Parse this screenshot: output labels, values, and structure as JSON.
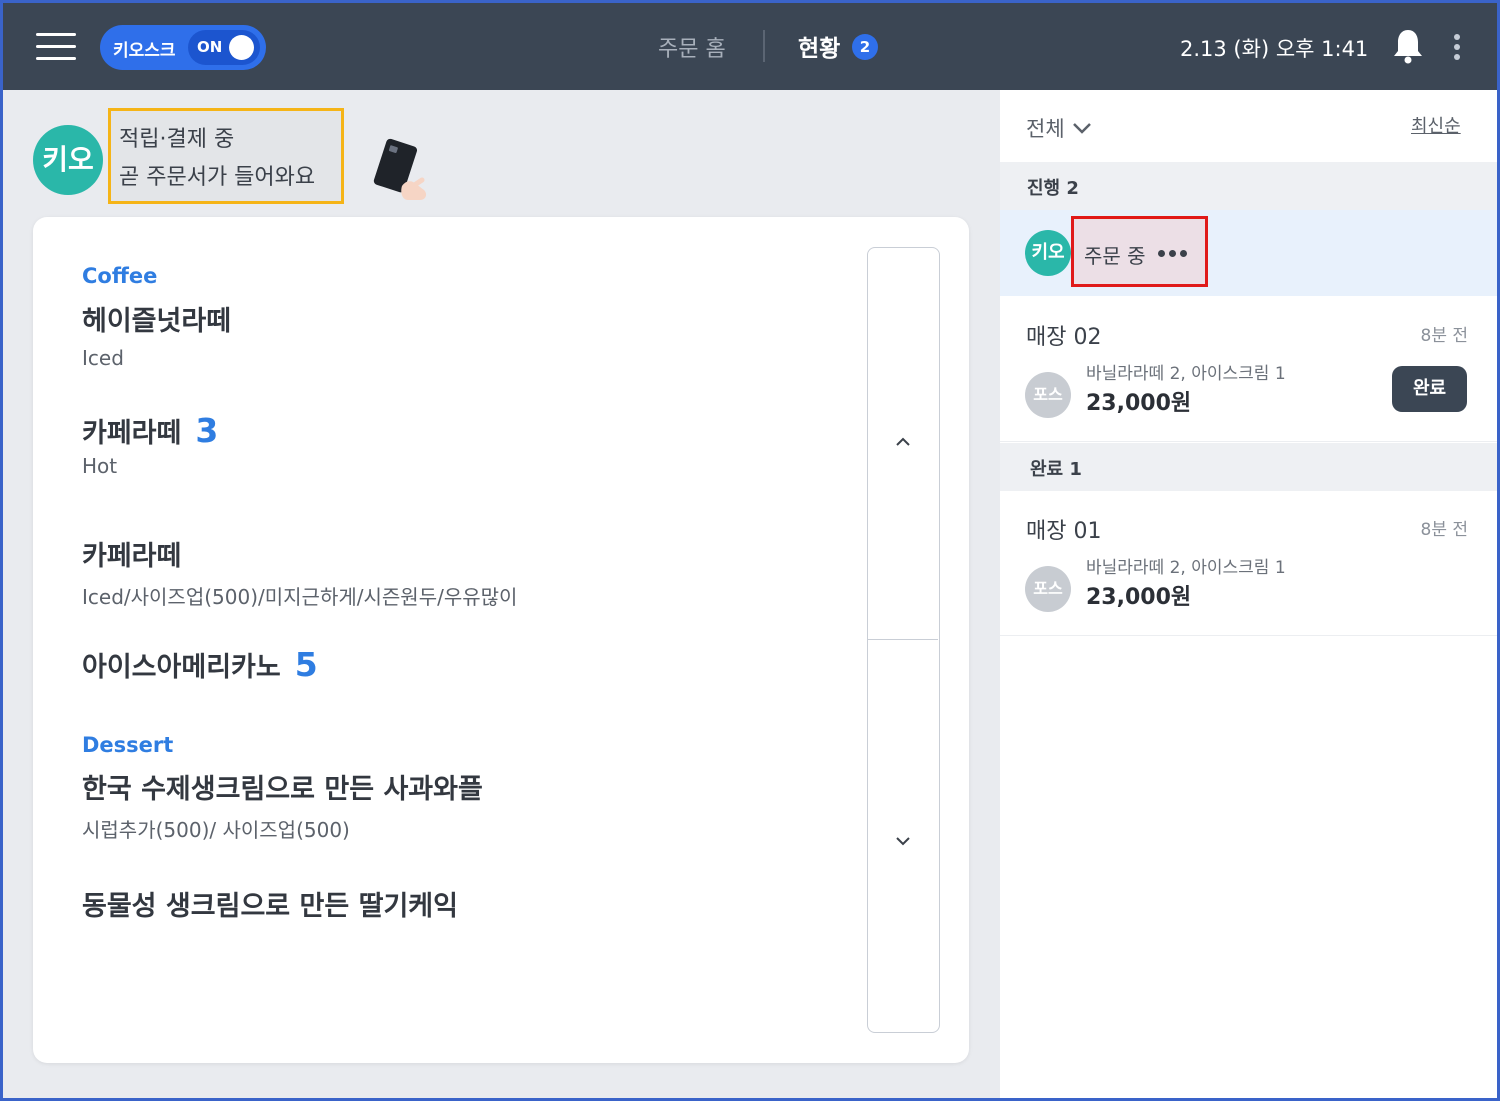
{
  "topbar": {
    "kiosk_label": "키오스크",
    "kiosk_toggle_state": "ON",
    "nav_home": "주문 홈",
    "nav_status": "현황",
    "status_badge": "2",
    "datetime": "2.13 (화) 오후 1:41",
    "icons": [
      "menu-icon",
      "bell-icon",
      "more-vertical-icon"
    ]
  },
  "notice": {
    "avatar": "키오",
    "line1": "적립·결제 중",
    "line2": "곧 주문서가 들어와요",
    "icon": "card-tap-icon"
  },
  "order_card": {
    "categories": [
      {
        "label": "Coffee",
        "items": [
          {
            "name": "헤이즐넛라떼",
            "qty": "",
            "options": "Iced"
          },
          {
            "name": "카페라떼",
            "qty": "3",
            "options": "Hot"
          },
          {
            "name": "카페라떼",
            "qty": "",
            "options": "Iced/사이즈업(500)/미지근하게/시즌원두/우유많이"
          },
          {
            "name": "아이스아메리카노",
            "qty": "5",
            "options": ""
          }
        ]
      },
      {
        "label": "Dessert",
        "items": [
          {
            "name": "한국 수제생크림으로 만든 사과와플",
            "qty": "",
            "options": "시럽추가(500)/ 사이즈업(500)"
          },
          {
            "name": "동물성 생크림으로 만든 딸기케익",
            "qty": "",
            "options": ""
          }
        ]
      }
    ],
    "scroll_icons": [
      "chevron-up-icon",
      "chevron-down-icon"
    ]
  },
  "right_panel": {
    "filter": "전체",
    "sort": "최신순",
    "in_progress_header": "진행 2",
    "active_order": {
      "avatar": "키오",
      "status": "주문 중"
    },
    "progress_orders": [
      {
        "store": "매장 02",
        "time": "8분 전",
        "avatar": "포스",
        "items": "바닐라라떼 2, 아이스크림 1",
        "price": "23,000원",
        "button": "완료"
      }
    ],
    "done_header": "완료 1",
    "done_orders": [
      {
        "store": "매장 01",
        "time": "8분 전",
        "avatar": "포스",
        "items": "바닐라라떼 2, 아이스크림 1",
        "price": "23,000원"
      }
    ]
  },
  "colors": {
    "topbar": "#3b4654",
    "accent_blue": "#2f6fea",
    "kio_teal": "#2ab7a9",
    "highlight_yellow": "#f5b417",
    "highlight_red": "#e01a1a"
  }
}
